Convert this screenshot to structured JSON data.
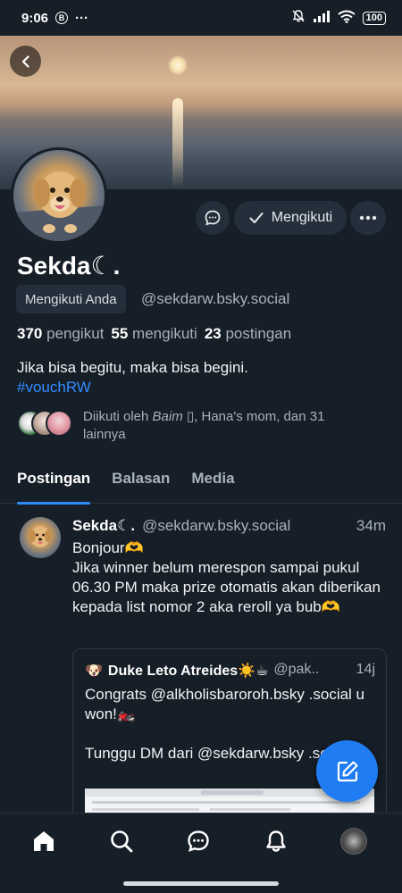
{
  "status_bar": {
    "time": "9:06",
    "b_icon": "B",
    "dots": "···",
    "battery": "100",
    "icons": [
      "bell-off-icon",
      "signal-icon",
      "wifi-icon",
      "battery-icon"
    ]
  },
  "profile": {
    "display_name": "Sekda☾.",
    "follows_you_label": "Mengikuti Anda",
    "handle": "@sekdarw.bsky.social",
    "stats": {
      "followers_count": "370",
      "followers_label": "pengikut",
      "following_count": "55",
      "following_label": "mengikuti",
      "posts_count": "23",
      "posts_label": "postingan"
    },
    "bio_line1": "Jika bisa begitu, maka bisa begini.",
    "bio_hashtag": "#vouchRW",
    "followed_by_prefix": "Diikuti oleh ",
    "followed_by_name": "Baim",
    "followed_by_suffix": " ▯, Hana's mom, dan 31 lainnya"
  },
  "actions": {
    "following_label": "Mengikuti"
  },
  "tabs": [
    {
      "label": "Postingan",
      "active": true
    },
    {
      "label": "Balasan",
      "active": false
    },
    {
      "label": "Media",
      "active": false
    }
  ],
  "post": {
    "author_name": "Sekda☾.",
    "author_handle": "@sekdarw.bsky.social",
    "time": "34m",
    "text": "Bonjour🫶\nJika winner belum merespon sampai pukul 06.30 PM maka prize otomatis akan diberikan kepada list nomor 2 aka reroll ya bub🫶",
    "quote": {
      "emoji": "🐶",
      "author_name": "Duke Leto Atreides☀️☕",
      "author_handle": "@pak..",
      "time": "14j",
      "text": "Congrats @alkholisbaroroh.bsky .social u won!🏍️\n\nTunggu DM dari @sekdarw.bsky .social ⚡"
    }
  },
  "colors": {
    "background": "#161e27",
    "surface": "#242f3b",
    "accent": "#2f8cff",
    "fab": "#1f7cf2",
    "muted_text": "#a8b2bd"
  },
  "nav": [
    "home-icon",
    "search-icon",
    "chat-icon",
    "bell-icon",
    "profile-avatar"
  ]
}
